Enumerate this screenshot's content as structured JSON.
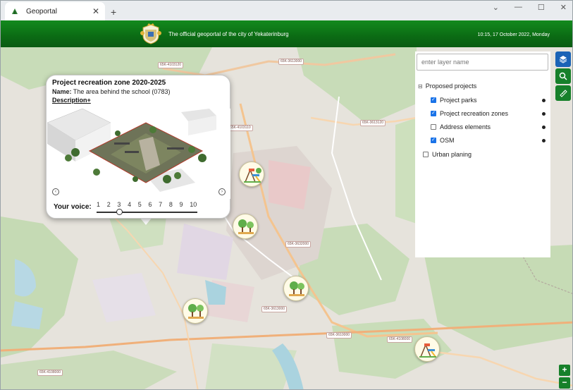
{
  "browser": {
    "tab_title": "Geoportal",
    "new_tab": "+",
    "close": "✕",
    "controls": [
      "⌄",
      "—",
      "☐",
      "✕"
    ]
  },
  "header": {
    "title": "The official geoportal of the city of Yekaterinburg",
    "datetime": "10:15, 17 October 2022, Monday"
  },
  "map": {
    "road_labels": [
      {
        "id": "r1",
        "text": "65K-4103120"
      },
      {
        "id": "r2",
        "text": "65K-3613000"
      },
      {
        "id": "r3",
        "text": "65K-3613120"
      },
      {
        "id": "r4",
        "text": "65K-4103110"
      },
      {
        "id": "r5",
        "text": "65K-3632000"
      },
      {
        "id": "r6",
        "text": "65K-3613000"
      },
      {
        "id": "r7",
        "text": "65K-3610000"
      },
      {
        "id": "r8",
        "text": "65K-4108000"
      },
      {
        "id": "r9",
        "text": "65K-4108000"
      }
    ]
  },
  "popup": {
    "title": "Project recreation zone 2020-2025",
    "name_label": "Name:",
    "name_value": "The area behind the school (0783)",
    "description_label": "Description+",
    "prev": "‹",
    "next": "›",
    "vote_label": "Your voice:",
    "vote_options": [
      "1",
      "2",
      "3",
      "4",
      "5",
      "6",
      "7",
      "8",
      "9",
      "10"
    ],
    "vote_selected": 3
  },
  "layers": {
    "search_placeholder": "enter layer name",
    "group": {
      "label": "Proposed projects",
      "collapse": "⊟"
    },
    "items": [
      {
        "label": "Project parks",
        "checked": true
      },
      {
        "label": "Project recreation zones",
        "checked": true
      },
      {
        "label": "Address elements",
        "checked": false
      },
      {
        "label": "OSM",
        "checked": true
      }
    ],
    "other": {
      "label": "Urban planing",
      "checked": false
    }
  },
  "tools": {
    "zoom_in": "+",
    "zoom_out": "−"
  }
}
